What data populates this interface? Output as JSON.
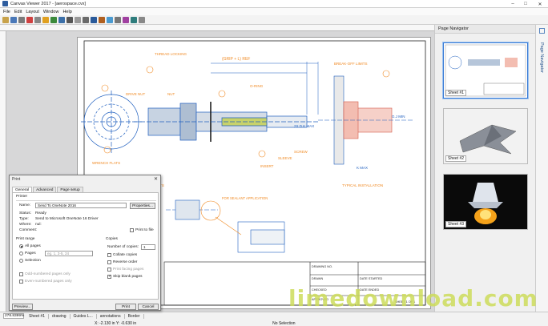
{
  "window": {
    "title": "Canvas Viewer 2017 - [aerospace.cvx]"
  },
  "menu": [
    "File",
    "Edit",
    "Layout",
    "Window",
    "Help"
  ],
  "drawing": {
    "labels": {
      "thread_locking": "THREAD LOCKING\nAREA",
      "grip": "(GRIP + L) REF",
      "grip_sub": "(GRIP + .100 IN.\n(2.54 MM) REF",
      "drive_nut": "DRIVE\nNUT",
      "nut": "NUT",
      "b": "B",
      "r": "R",
      "head": "HEAD",
      "x_ref": "X REF",
      "o_ring": "O-RING\n(OPTIONAL)",
      "breakoff": "BREAK-OFF LIMITS\n(MEASURED FROM\nSKIN SURFACE)",
      "max_dim": "2X D.K MAX",
      "screw": "SCREW",
      "sleeve": "SLEEVE",
      "insert": "INSERT",
      "expansion_sleeve": "EXPANSION\nSLEEVE",
      "wrench_flats": "2\nWRENCH\nFLATS",
      "tiher": "TIHER\nACROSS FLATS",
      "sealant": "FOR SEALANT APPLICATION\nEXPOSE TWO TO FOUR THREADS",
      "typical_install": "TYPICAL INSTALLATION",
      "g_min": "G.J MIN",
      "k_max": "K MAX",
      "n1": "1",
      "n2": "2",
      "n3": "3",
      "n4": "4",
      "n5": "5",
      "n6": "6",
      "n7": "7",
      "n8": "8"
    },
    "titleblock": {
      "drawing_no": "DRAWING NO.",
      "drawn": "DRAWN",
      "checked": "CHECKED",
      "approved": "APPROVED",
      "sheet": "SHEET 1 OF 1",
      "date_started": "DATE STARTED",
      "date_ended": "DATE ENDED",
      "rev": "REV"
    }
  },
  "navigator": {
    "title": "Page Navigator",
    "side_tab": "Page Navigator",
    "sheets": [
      "Sheet #1",
      "Sheet #2",
      "Sheet #3"
    ]
  },
  "print": {
    "title": "Print",
    "tabs": [
      "General",
      "Advanced",
      "Page setup"
    ],
    "printer_group": "Printer",
    "name_label": "Name:",
    "name_value": "Send To OneNote 2016",
    "properties": "Properties...",
    "status_label": "Status:",
    "status_value": "Ready",
    "type_label": "Type:",
    "type_value": "Send to Microsoft OneNote 16 Driver",
    "where_label": "Where:",
    "where_value": "nul:",
    "comment_label": "Comment:",
    "print_to_file": "Print to file",
    "range_group": "Print range",
    "all_pages": "All pages",
    "pages": "Pages",
    "pages_placeholder": "eg. 1, 3-5, 24",
    "selection": "Selection",
    "odd_pages": "Odd-numbered pages only",
    "even_pages": "Even-numbered pages only",
    "copies_group": "Copies",
    "num_copies_label": "Number of copies:",
    "num_copies": "1",
    "collate": "Collate copies",
    "reverse": "Reverse order",
    "facing": "Print facing pages",
    "skip_blank": "Skip blank pages",
    "preview": "Preview...",
    "print_btn": "Print",
    "cancel_btn": "Cancel"
  },
  "status": {
    "zoom": "278.8399%",
    "sheet_selector": "Sheet #1",
    "tabs": [
      "drawing",
      "Guides L...",
      "annotations",
      "Border"
    ],
    "coords": "X: -2.130 in  Y: -0.630 in",
    "selection": "No Selection"
  },
  "watermark": {
    "text": "limedownload.com"
  },
  "colors": {
    "accent": "#3a7bd5",
    "drawing_blue": "#1f5fbf",
    "annotation_orange": "#f08a24"
  }
}
